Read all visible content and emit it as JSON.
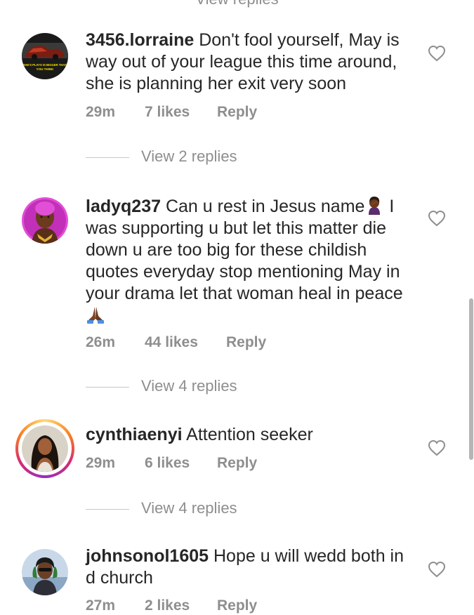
{
  "top_partial_text": "View replies",
  "comments": [
    {
      "username": "3456.lorraine",
      "text": "Don't fool yourself,  May is way out of your league this time around, she is planning her exit very soon",
      "time": "29m",
      "likes": "7 likes",
      "reply": "Reply",
      "view_replies": "View 2 replies",
      "avatar_caption_1": "SHE'S PLAYS IS BIGGER THAN",
      "avatar_caption_2": "YOU THINK"
    },
    {
      "username": "ladyq237",
      "text": "Can u rest in Jesus name",
      "text_after_emoji": " I was supporting u but let this matter die down u are too big for these childish quotes everyday stop mentioning May in your drama let that woman heal in peace ",
      "emoji_1": "woman-facepalming",
      "emoji_2": "folded-hands",
      "time": "26m",
      "likes": "44 likes",
      "reply": "Reply",
      "view_replies": "View 4 replies"
    },
    {
      "username": "cynthiaenyi",
      "text": "Attention seeker",
      "time": "29m",
      "likes": "6 likes",
      "reply": "Reply",
      "view_replies": "View 4 replies"
    },
    {
      "username": "johnsonol1605",
      "text": "Hope u will wedd both in d church",
      "time": "27m",
      "likes": "2 likes",
      "reply": "Reply"
    }
  ],
  "icons": {
    "like": "heart-outline-icon"
  },
  "colors": {
    "text": "#262626",
    "secondary": "#8e8e8e",
    "divider": "#c7c7c7"
  }
}
